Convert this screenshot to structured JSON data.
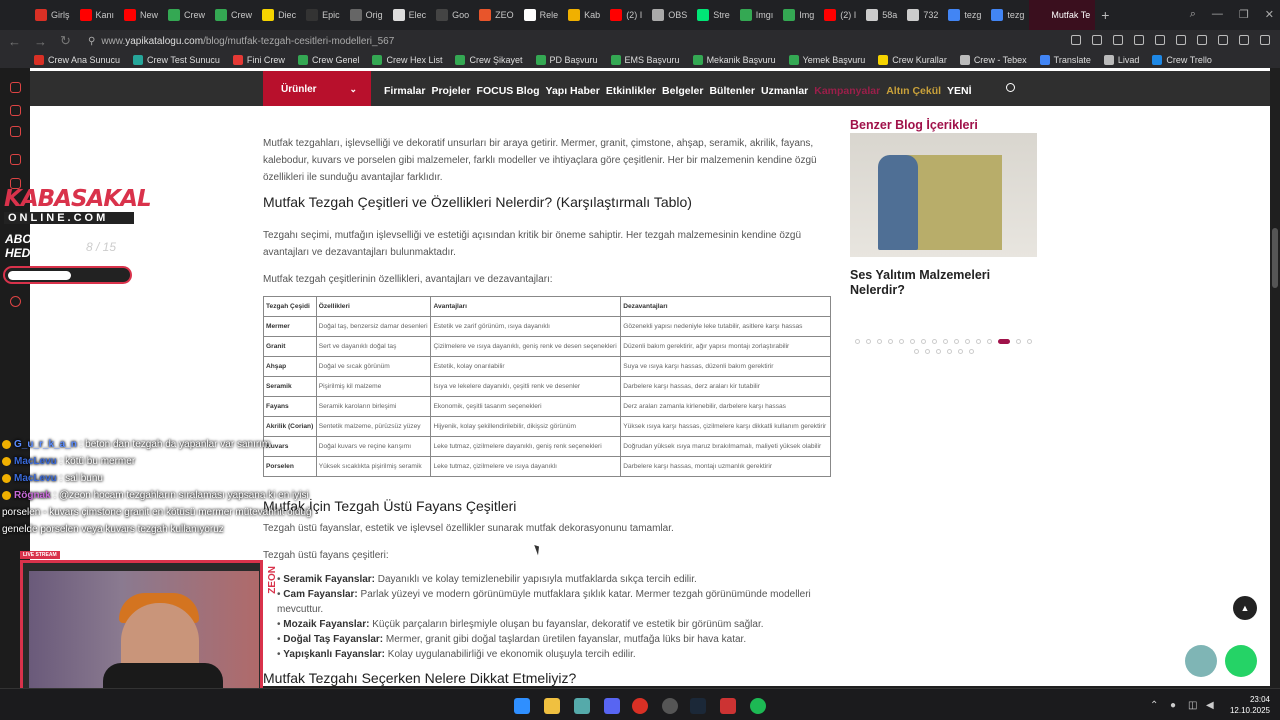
{
  "browser": {
    "tabs": [
      {
        "label": "Girlş",
        "color": "#d93025"
      },
      {
        "label": "Kanı",
        "color": "#ff0000"
      },
      {
        "label": "New",
        "color": "#ff0000"
      },
      {
        "label": "Crew",
        "color": "#34a853"
      },
      {
        "label": "Crew",
        "color": "#34a853"
      },
      {
        "label": "Diec",
        "color": "#f5d300"
      },
      {
        "label": "Epic",
        "color": "#333333"
      },
      {
        "label": "Orig",
        "color": "#666666"
      },
      {
        "label": "Elec",
        "color": "#dddddd"
      },
      {
        "label": "Goo",
        "color": "#444444"
      },
      {
        "label": "ZEO",
        "color": "#e8552b"
      },
      {
        "label": "Rele",
        "color": "#ffffff"
      },
      {
        "label": "Kab",
        "color": "#f0b000"
      },
      {
        "label": "(2) I",
        "color": "#ff0000"
      },
      {
        "label": "OBS",
        "color": "#aaaaaa"
      },
      {
        "label": "Stre",
        "color": "#00e676"
      },
      {
        "label": "Imgı",
        "color": "#34a853"
      },
      {
        "label": "Img",
        "color": "#34a853"
      },
      {
        "label": "(2) I",
        "color": "#ff0000"
      },
      {
        "label": "58a",
        "color": "#cccccc"
      },
      {
        "label": "732",
        "color": "#cccccc"
      },
      {
        "label": "tezg",
        "color": "#4285f4"
      },
      {
        "label": "tezg",
        "color": "#4285f4"
      }
    ],
    "active_tab": "Mutfak Te",
    "add_tab": "+",
    "url_prefix": "www.",
    "url_domain": "yapikatalogu.com",
    "url_path": "/blog/mutfak-tezgah-cesitleri-modelleri_567",
    "bookmarks": [
      {
        "label": "Crew Ana Sunucu",
        "color": "#d93025"
      },
      {
        "label": "Crew Test Sunucu",
        "color": "#26a69a"
      },
      {
        "label": "Fini Crew",
        "color": "#e53935"
      },
      {
        "label": "Crew Genel",
        "color": "#34a853"
      },
      {
        "label": "Crew Hex List",
        "color": "#34a853"
      },
      {
        "label": "Crew Şikayet",
        "color": "#34a853"
      },
      {
        "label": "PD Başvuru",
        "color": "#34a853"
      },
      {
        "label": "EMS Başvuru",
        "color": "#34a853"
      },
      {
        "label": "Mekanik Başvuru",
        "color": "#34a853"
      },
      {
        "label": "Yemek Başvuru",
        "color": "#34a853"
      },
      {
        "label": "Crew Kurallar",
        "color": "#f5d300"
      },
      {
        "label": "Crew - Tebex",
        "color": "#bbbbbb"
      },
      {
        "label": "Translate",
        "color": "#4285f4"
      },
      {
        "label": "Livad",
        "color": "#bbbbbb"
      },
      {
        "label": "Crew Trello",
        "color": "#1e88e5"
      }
    ]
  },
  "site": {
    "menu_button": "Ürünler",
    "nav": [
      "Firmalar",
      "Projeler",
      "FOCUS Blog",
      "Yapı Haber",
      "Etkinlikler",
      "Belgeler",
      "Bültenler",
      "Uzmanlar"
    ],
    "nav_hot": "Kampanyalar",
    "nav_gold": "Altın Çekül",
    "nav_new": "YENİ"
  },
  "article": {
    "intro": "Mutfak tezgahları, işlevselliği ve dekoratif unsurları bir araya getirir. Mermer, granit, çimstone, ahşap, seramik, akrilik, fayans, kalebodur, kuvars ve porselen gibi malzemeler, farklı modeller ve ihtiyaçlara göre çeşitlenir. Her bir malzemenin kendine özgü özellikleri ile sunduğu avantajlar farklıdır.",
    "h2_table": "Mutfak Tezgah Çeşitleri ve Özellikleri Nelerdir? (Karşılaştırmalı Tablo)",
    "p_select": "Tezgahı seçimi, mutfağın işlevselliği ve estetiği açısından kritik bir öneme sahiptir. Her tezgah malzemesinin kendine özgü avantajları ve dezavantajları bulunmaktadır.",
    "p_table_intro": "Mutfak tezgah çeşitlerinin özellikleri, avantajları ve dezavantajları:",
    "table": {
      "headers": [
        "Tezgah Çeşidi",
        "Özellikleri",
        "Avantajları",
        "Dezavantajları"
      ],
      "rows": [
        [
          "Mermer",
          "Doğal taş, benzersiz damar desenleri",
          "Estetik ve zarif görünüm, ısıya dayanıklı",
          "Gözenekli yapısı nedeniyle leke tutabilir, asitlere karşı hassas"
        ],
        [
          "Granit",
          "Sert ve dayanıklı doğal taş",
          "Çizilmelere ve ısıya dayanıklı, geniş renk ve desen seçenekleri",
          "Düzenli bakım gerektirir, ağır yapısı montajı zorlaştırabilir"
        ],
        [
          "Ahşap",
          "Doğal ve sıcak görünüm",
          "Estetik, kolay onarılabilir",
          "Suya ve ısıya karşı hassas, düzenli bakım gerektirir"
        ],
        [
          "Seramik",
          "Pişirilmiş kil malzeme",
          "Isıya ve lekelere dayanıklı, çeşitli renk ve desenler",
          "Darbelere karşı hassas, derz araları kir tutabilir"
        ],
        [
          "Fayans",
          "Seramik karoların birleşimi",
          "Ekonomik, çeşitli tasarım seçenekleri",
          "Derz araları zamanla kirlenebilir, darbelere karşı hassas"
        ],
        [
          "Akrilik (Corian)",
          "Sentetik malzeme, pürüzsüz yüzey",
          "Hijyenik, kolay şekillendirilebilir, dikişsiz görünüm",
          "Yüksek ısıya karşı hassas, çizilmelere karşı dikkatli kullanım gerektirir"
        ],
        [
          "Kuvars",
          "Doğal kuvars ve reçine karışımı",
          "Leke tutmaz, çizilmelere dayanıklı, geniş renk seçenekleri",
          "Doğrudan yüksek ısıya maruz bırakılmamalı, maliyeti yüksek olabilir"
        ],
        [
          "Porselen",
          "Yüksek sıcaklıkta pişirilmiş seramik",
          "Leke tutmaz, çizilmelere ve ısıya dayanıklı",
          "Darbelere karşı hassas, montajı uzmanlık gerektirir"
        ]
      ]
    },
    "h2_fayans": "Mutfak İçin Tezgah Üstü Fayans Çeşitleri",
    "p_fayans": "Tezgah üstü fayanslar, estetik ve işlevsel özellikler sunarak mutfak dekorasyonunu tamamlar.",
    "p_fayans_list": "Tezgah üstü fayans çeşitleri:",
    "tiles": [
      {
        "name": "Seramik Fayanslar:",
        "desc": " Dayanıklı ve kolay temizlenebilir yapısıyla mutfaklarda sıkça tercih edilir."
      },
      {
        "name": "Cam Fayanslar:",
        "desc": " Parlak yüzeyi ve modern görünümüyle mutfaklara şıklık katar. Mermer tezgah görünümünde modelleri mevcuttur."
      },
      {
        "name": "Mozaik Fayanslar:",
        "desc": " Küçük parçaların birleşmiyle oluşan bu fayanslar, dekoratif ve estetik bir görünüm sağlar."
      },
      {
        "name": "Doğal Taş Fayanslar:",
        "desc": " Mermer, granit gibi doğal taşlardan üretilen fayanslar, mutfağa lüks bir hava katar."
      },
      {
        "name": "Yapışkanlı Fayanslar:",
        "desc": " Kolay uygulanabilirliği ve ekonomik oluşuyla tercih edilir."
      }
    ],
    "h2_select": "Mutfak Tezgahı Seçerken Nelere Dikkat Etmeliyiz?"
  },
  "sidebar": {
    "title": "Benzer Blog İçerikleri",
    "post_title": "Ses Yalıtım Malzemeleri Nelerdir?",
    "dots_total": 22,
    "dots_active": 13
  },
  "overlay": {
    "logo_top": "KABASAKAL",
    "logo_bottom": "ONLINE.COM",
    "abone_line1": "ABONE",
    "abone_line2": "HEDİYESİ",
    "abone_count": "8 / 15",
    "progress": 0.53,
    "zeon": "ZEON",
    "live": "LIVE STREAM",
    "chat": [
      {
        "user": "G_u_r_k_a_n",
        "msg": " : beton dan tezgah da yapanlar var sanırım",
        "cls": "u1"
      },
      {
        "user": "MacLevu",
        "msg": " : kötü bu mermer",
        "cls": "u2"
      },
      {
        "user": "MacLevu",
        "msg": " : sal bunu",
        "cls": "u2"
      },
      {
        "user": "Rögnak",
        "msg": " : @zeon hocam tezgahların sıralaması yapsana ki en iyisi porselen - kuvars çimstone granit en kötüsü mermer mütevahhit olduğ genelde porselen veya kuvars tezgah kullanıyoruz",
        "cls": "u3"
      }
    ]
  },
  "taskbar": {
    "time": "23:04",
    "date": "12.10.2025"
  }
}
